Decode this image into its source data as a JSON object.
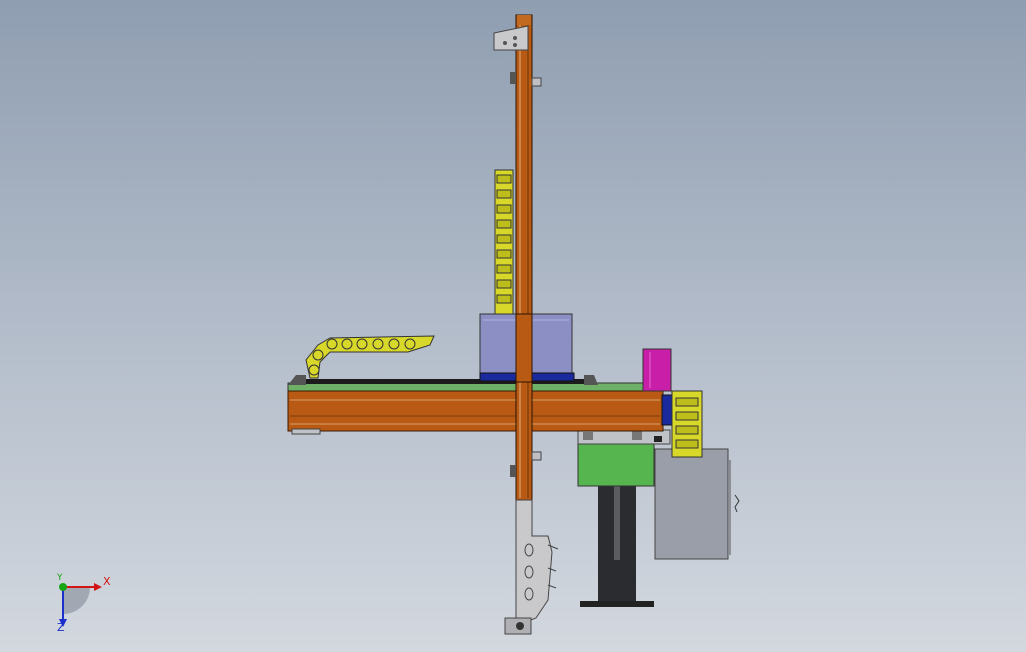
{
  "viewport": {
    "background_top": "#8f9eb1",
    "background_bottom": "#d3d8df"
  },
  "model": {
    "colors": {
      "beam_orange": "#b85a14",
      "carriage_purple": "#8c8fc4",
      "cable_chain_yellow": "#d8d82a",
      "motor_magenta": "#c81ea8",
      "base_green": "#56b54e",
      "panel_gray": "#9a9ea8",
      "gripper_silver": "#c9c9cc",
      "column_dark": "#2a2c30"
    }
  },
  "triad": {
    "x_label": "X",
    "y_label": "Y",
    "z_label": "Z",
    "x_color": "#d21616",
    "y_color": "#15a515",
    "z_color": "#1a2fcc"
  }
}
